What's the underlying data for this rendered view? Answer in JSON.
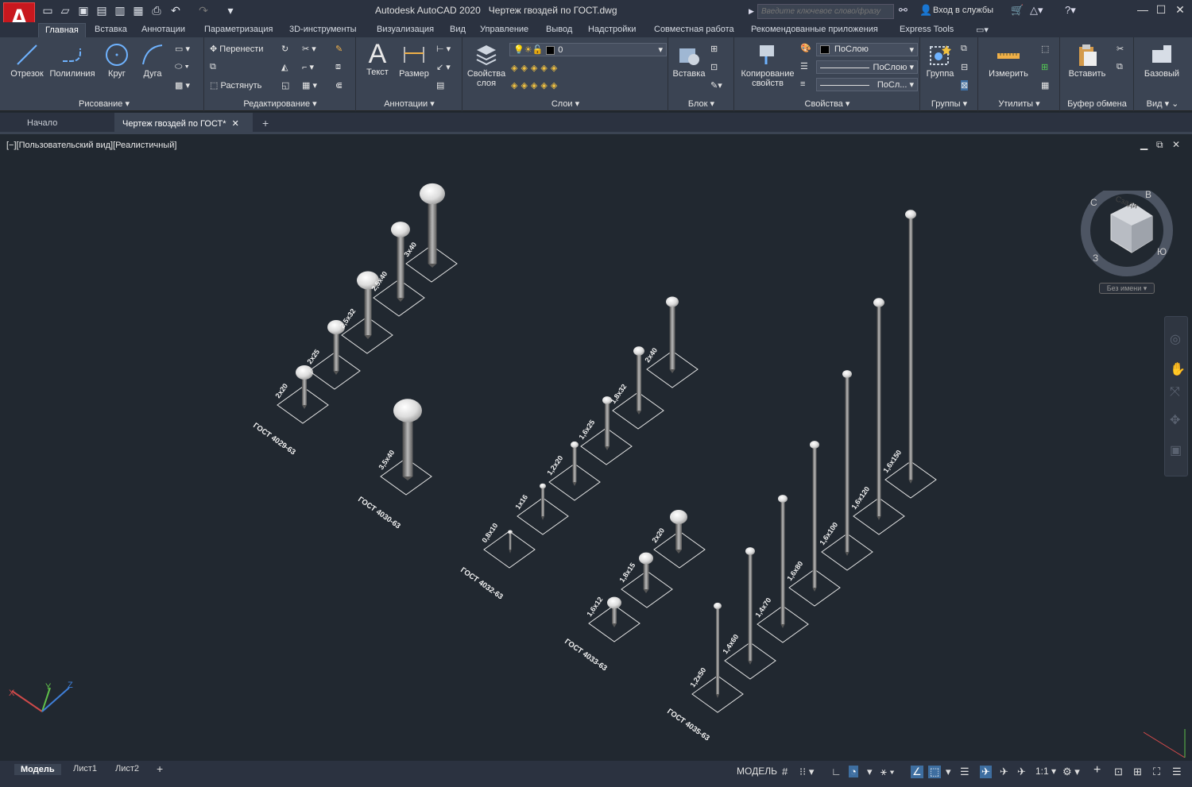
{
  "app": {
    "logo_letter": "A",
    "title": "Autodesk AutoCAD 2020",
    "file": "Чертеж гвоздей по ГОСТ.dwg",
    "search_placeholder": "Введите ключевое слово/фразу",
    "signin": "Вход в службы",
    "brand_color": "#c8181e"
  },
  "ribbon_tabs": [
    "Главная",
    "Вставка",
    "Аннотации",
    "Параметризация",
    "3D-инструменты",
    "Визуализация",
    "Вид",
    "Управление",
    "Вывод",
    "Надстройки",
    "Совместная работа",
    "Рекомендованные приложения",
    "Express Tools"
  ],
  "ribbon": {
    "draw": {
      "line": "Отрезок",
      "polyline": "Полилиния",
      "circle": "Круг",
      "arc": "Дуга",
      "label": "Рисование"
    },
    "modify": {
      "move": "Перенести",
      "stretch": "Растянуть",
      "label": "Редактирование"
    },
    "annotation": {
      "text": "Текст",
      "dimension": "Размер",
      "label": "Аннотации"
    },
    "layers": {
      "props": "Свойства",
      "props2": "слоя",
      "current": "0",
      "label": "Слои"
    },
    "block": {
      "insert": "Вставка",
      "label": "Блок"
    },
    "properties": {
      "match": "Копирование",
      "match2": "свойств",
      "color": "ПоСлою",
      "linetype": "ПоСлою",
      "lineweight": "ПоСл...",
      "label": "Свойства"
    },
    "groups": {
      "group": "Группа",
      "label": "Группы"
    },
    "utilities": {
      "measure": "Измерить",
      "label": "Утилиты"
    },
    "clipboard": {
      "paste": "Вставить",
      "label": "Буфер обмена"
    },
    "view": {
      "base": "Базовый",
      "label": "Вид"
    }
  },
  "doc_tabs": {
    "start": "Начало",
    "drawing": "Чертеж гвоздей по ГОСТ*"
  },
  "viewport": {
    "label": "[−][Пользовательский вид][Реалистичный]",
    "viewcube_face": "Сзади",
    "compass": {
      "n": "С",
      "e": "В",
      "s": "Ю",
      "w": "З"
    },
    "ucs_name": "Без имени"
  },
  "nail_groups": [
    {
      "gost": "ГОСТ 4029-63",
      "sizes": [
        "2х20",
        "2х25",
        "2,5х32",
        "2,5х40",
        "3х40"
      ]
    },
    {
      "gost": "ГОСТ 4030-63",
      "sizes": [
        "3,5х40"
      ]
    },
    {
      "gost": "ГОСТ 4032-63",
      "sizes": [
        "0,8х10",
        "1х16",
        "1,2х20",
        "1,6х25",
        "1,8х32",
        "2х40"
      ]
    },
    {
      "gost": "ГОСТ 4033-63",
      "sizes": [
        "1,6х12",
        "1,8х15",
        "2х20"
      ]
    },
    {
      "gost": "ГОСТ 4035-63",
      "sizes": [
        "1,2х50",
        "1,4х60",
        "1,4х70",
        "1,6х80",
        "1,6х100",
        "1,6х120",
        "1,6х150"
      ]
    }
  ],
  "status": {
    "tabs": [
      "Модель",
      "Лист1",
      "Лист2"
    ],
    "mode": "МОДЕЛЬ",
    "scale": "1:1"
  }
}
